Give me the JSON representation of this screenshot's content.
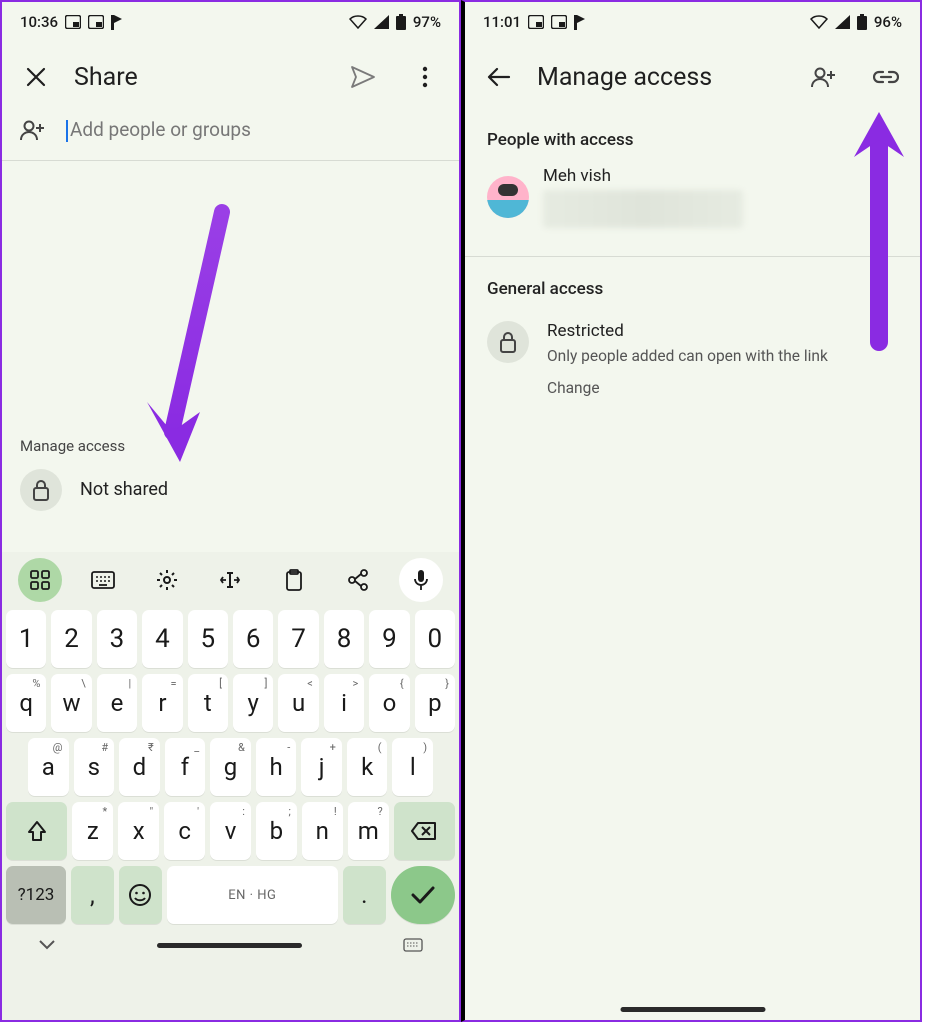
{
  "left": {
    "status": {
      "time": "10:36",
      "battery": "97%"
    },
    "appbar": {
      "title": "Share"
    },
    "input": {
      "placeholder": "Add people or groups"
    },
    "manage": {
      "label": "Manage access",
      "status": "Not shared"
    },
    "keyboard": {
      "row1": [
        "1",
        "2",
        "3",
        "4",
        "5",
        "6",
        "7",
        "8",
        "9",
        "0"
      ],
      "row2": [
        {
          "k": "q",
          "h": "%"
        },
        {
          "k": "w",
          "h": "\\"
        },
        {
          "k": "e",
          "h": "|"
        },
        {
          "k": "r",
          "h": "="
        },
        {
          "k": "t",
          "h": "["
        },
        {
          "k": "y",
          "h": "]"
        },
        {
          "k": "u",
          "h": "<"
        },
        {
          "k": "i",
          "h": ">"
        },
        {
          "k": "o",
          "h": "{"
        },
        {
          "k": "p",
          "h": "}"
        }
      ],
      "row3": [
        {
          "k": "a",
          "h": "@"
        },
        {
          "k": "s",
          "h": "#"
        },
        {
          "k": "d",
          "h": "₹"
        },
        {
          "k": "f",
          "h": "_"
        },
        {
          "k": "g",
          "h": "&"
        },
        {
          "k": "h",
          "h": "-"
        },
        {
          "k": "j",
          "h": "+"
        },
        {
          "k": "k",
          "h": "("
        },
        {
          "k": "l",
          "h": ")"
        }
      ],
      "row4": [
        {
          "k": "z",
          "h": "*"
        },
        {
          "k": "x",
          "h": "\""
        },
        {
          "k": "c",
          "h": "'"
        },
        {
          "k": "v",
          "h": ":"
        },
        {
          "k": "b",
          "h": ";"
        },
        {
          "k": "n",
          "h": "!"
        },
        {
          "k": "m",
          "h": "?"
        }
      ],
      "sym": "?123",
      "space": "EN · HG",
      "period": ".",
      "comma": ","
    }
  },
  "right": {
    "status": {
      "time": "11:01",
      "battery": "96%"
    },
    "appbar": {
      "title": "Manage access"
    },
    "people": {
      "heading": "People with access",
      "name": "Meh vish"
    },
    "general": {
      "heading": "General access",
      "title": "Restricted",
      "desc": "Only people added can open with the link",
      "change": "Change"
    }
  }
}
